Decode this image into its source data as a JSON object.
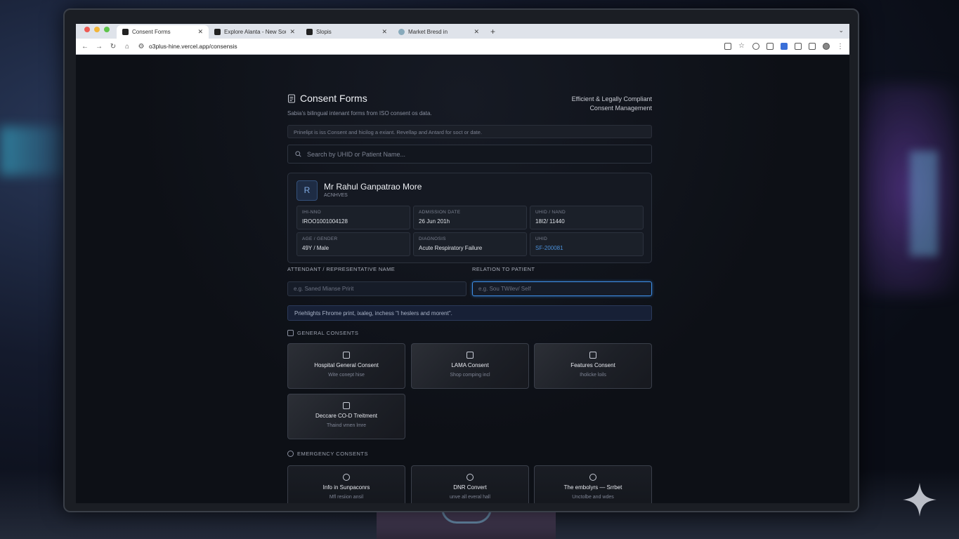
{
  "browser": {
    "tabs": [
      {
        "title": "Consent Forms",
        "active": true
      },
      {
        "title": "Explore Alanta - New Sourc",
        "active": false
      },
      {
        "title": "Slopis",
        "active": false
      },
      {
        "title": "Market Bresd in",
        "active": false
      }
    ],
    "url": "o3plus-hine.vercel.app/consensis"
  },
  "header": {
    "title": "Consent Forms",
    "subtitle": "Sabia's bilingual intenant forms from ISO consent os data.",
    "tagline_line1": "Efficient & Legally Compliant",
    "tagline_line2": "Consent Management"
  },
  "notice": "Prinelipt is iss Consent and hicilog a exiant. Revellap and Antard for soct or date.",
  "search": {
    "placeholder": "Search by UHID or Patient Name..."
  },
  "patient": {
    "initial": "R",
    "name": "Mr Rahul Ganpatrao More",
    "status": "ACNHVES",
    "fields": [
      {
        "label": "IHI-NNO",
        "value": "IROO1001004128"
      },
      {
        "label": "ADMISSION DATE",
        "value": "26 Jun 201h"
      },
      {
        "label": "UHID / NAND",
        "value": "18I2/ 11440"
      },
      {
        "label": "AGE / GENDER",
        "value": "49Y / Male"
      },
      {
        "label": "DIAGNOSIS",
        "value": "Acute Respiratory Failure"
      },
      {
        "label": "UHID",
        "value": "SF-200081"
      }
    ]
  },
  "form": {
    "attendant_label": "ATTENDANT / REPRESENTATIVE NAME",
    "attendant_placeholder": "e.g. Saned Mianse Pririt",
    "relation_label": "RELATION TO PATIENT",
    "relation_placeholder": "e.g. Sou TWilev/ Self"
  },
  "hint": "Priehlights Fhrome print, ixaleg, inchess \"I heslers and morent\".",
  "general": {
    "heading": "GENERAL CONSENTS",
    "tiles": [
      {
        "title": "Hospital General Consent",
        "sub": "Wite conept hise",
        "icon": "clipboard-icon"
      },
      {
        "title": "LAMA Consent",
        "sub": "Shop comping incl",
        "icon": "exit-icon"
      },
      {
        "title": "Features Consent",
        "sub": "Iholicke loils",
        "icon": "truck-icon"
      },
      {
        "title": "Deccare CO-D Treitment",
        "sub": "Thaind vmen lmre",
        "icon": "clipboard-check-icon"
      }
    ]
  },
  "emergency": {
    "heading": "EMERGENCY CONSENTS",
    "tiles": [
      {
        "title": "Info in Sunpaconrs",
        "sub": "Mfl resiion ansil",
        "icon": "info-icon"
      },
      {
        "title": "DNR Convert",
        "sub": "unve all everal hall",
        "icon": "heart-icon"
      },
      {
        "title": "The embolyrs — Srrbet",
        "sub": "Unctolbe and wdes",
        "icon": "person-badge-icon"
      }
    ]
  }
}
